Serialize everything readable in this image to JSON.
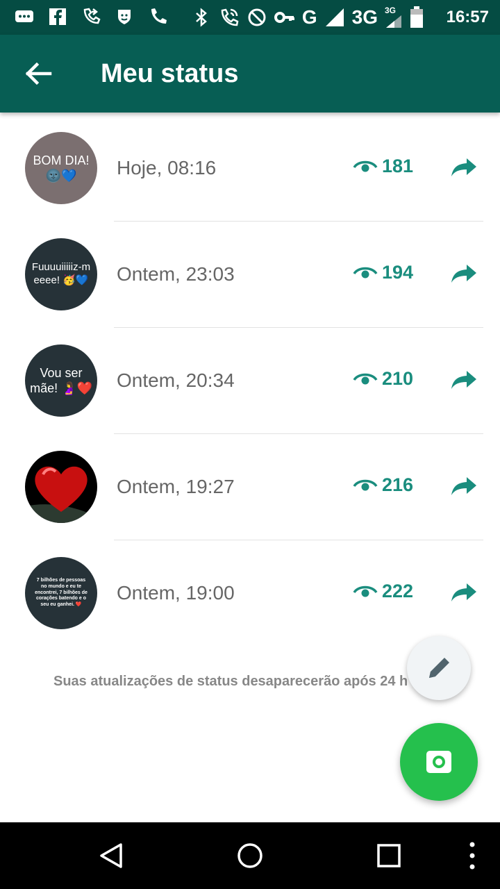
{
  "status_bar": {
    "time": "16:57",
    "network_1": "G",
    "network_2": "3G",
    "network_2_small": "3G",
    "left_icons": [
      "chat-bubble-icon",
      "facebook-icon",
      "call-forward-icon",
      "shield-icon",
      "phone-icon"
    ],
    "right_icons": [
      "bluetooth-icon",
      "wifi-call-icon",
      "block-icon",
      "key-icon",
      "signal-icon",
      "battery-icon"
    ]
  },
  "app_bar": {
    "title": "Meu status",
    "back_icon": "arrow-back-icon"
  },
  "statuses": [
    {
      "avatar_text": "BOM DIA! 🌚💙",
      "avatar_bg": "#7b6f70",
      "time": "Hoje, 08:16",
      "views": "181"
    },
    {
      "avatar_text": "Fuuuuiiiiiz-meeee! 🥳💙",
      "avatar_bg": "#263238",
      "time": "Ontem, 23:03",
      "views": "194"
    },
    {
      "avatar_text": "Vou ser mãe! 🤰❤️",
      "avatar_bg": "#263238",
      "time": "Ontem, 20:34",
      "views": "210"
    },
    {
      "avatar_text": "",
      "avatar_bg": "#000000",
      "time": "Ontem, 19:27",
      "views": "216"
    },
    {
      "avatar_text": "7 bilhões de pessoas no mundo e eu te encontrei, 7 bilhões de corações batendo e o seu eu ganhei. ❤️",
      "avatar_bg": "#263238",
      "time": "Ontem, 19:00",
      "views": "222"
    }
  ],
  "footer_note": "Suas atualizações de status desaparecerão após 24 h",
  "colors": {
    "status_bar": "#054c43",
    "app_bar": "#075e54",
    "accent": "#1a8d7e",
    "fab_camera": "#25c04d"
  }
}
